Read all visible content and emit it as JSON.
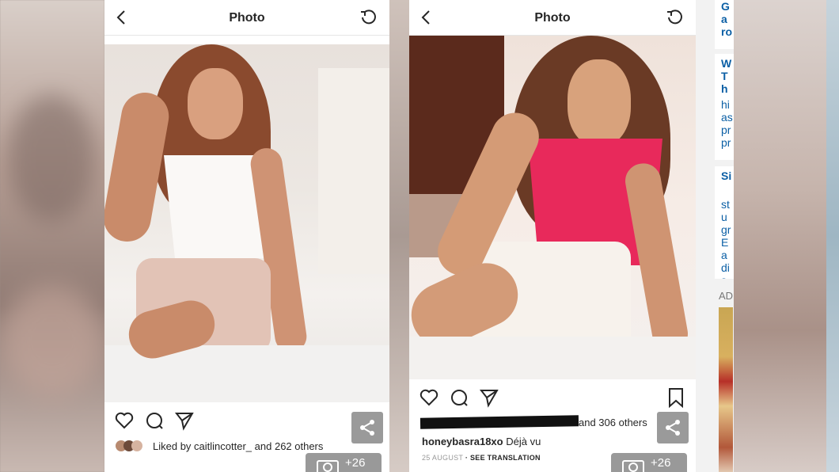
{
  "left_post": {
    "title": "Photo",
    "liked_by_prefix": "Liked by",
    "liked_by_user": "caitlincotter_",
    "liked_by_suffix": "and 262 others",
    "camera_count": "+26"
  },
  "right_post": {
    "title": "Photo",
    "liked_by_suffix": "and 306 others",
    "caption_user": "honeybasra18xo",
    "caption_text": "Déjà vu",
    "date": "25 AUGUST",
    "see_translation": "· SEE TRANSLATION",
    "camera_count": "+26"
  },
  "sidebar": {
    "item1": "Ga ro",
    "item2_title": "W Th",
    "item2_body": "hi as pr pr",
    "item3_title": "Si",
    "item3_body": "stu gr Ea dis all jur",
    "ad_label": "AD"
  },
  "icons": [
    "back-icon",
    "refresh-icon",
    "heart-icon",
    "comment-icon",
    "send-icon",
    "bookmark-icon",
    "share-icon",
    "camera-icon"
  ],
  "colors": {
    "accent_link": "#0b5fa5",
    "text": "#262626"
  }
}
